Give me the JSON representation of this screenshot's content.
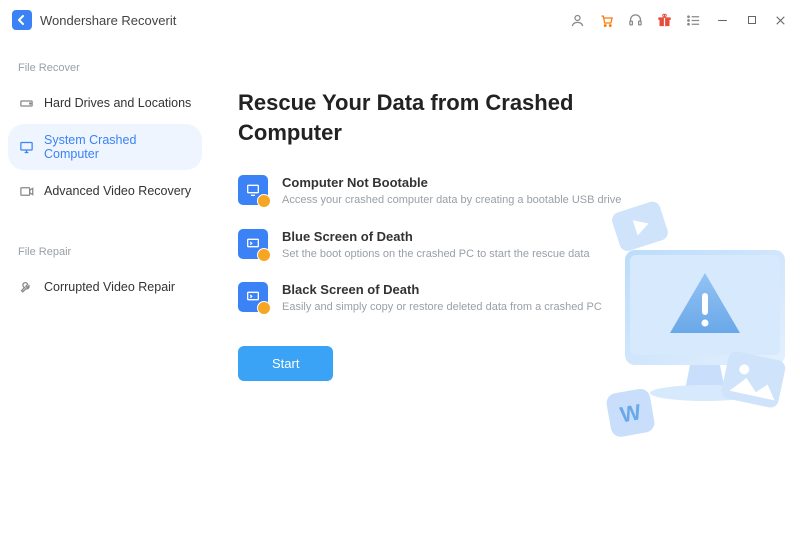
{
  "app": {
    "title": "Wondershare Recoverit"
  },
  "sidebar": {
    "section_recover_label": "File Recover",
    "section_repair_label": "File Repair",
    "items": [
      {
        "label": "Hard Drives and Locations"
      },
      {
        "label": "System Crashed Computer"
      },
      {
        "label": "Advanced Video Recovery"
      }
    ],
    "repair_items": [
      {
        "label": "Corrupted Video Repair"
      }
    ]
  },
  "main": {
    "title": "Rescue Your Data from Crashed Computer",
    "features": [
      {
        "title": "Computer Not Bootable",
        "desc": "Access your crashed computer data by creating a bootable USB drive"
      },
      {
        "title": "Blue Screen of Death",
        "desc": "Set the boot options on the crashed PC to start the rescue data"
      },
      {
        "title": "Black Screen of Death",
        "desc": "Easily and simply copy or restore deleted data from a crashed PC"
      }
    ],
    "start_label": "Start"
  },
  "colors": {
    "accent": "#3b82f6",
    "accent_light": "#eef5fe",
    "button": "#3aa3f5",
    "badge": "#f6a623",
    "cart": "#ff7a00",
    "gift": "#e74c3c"
  }
}
